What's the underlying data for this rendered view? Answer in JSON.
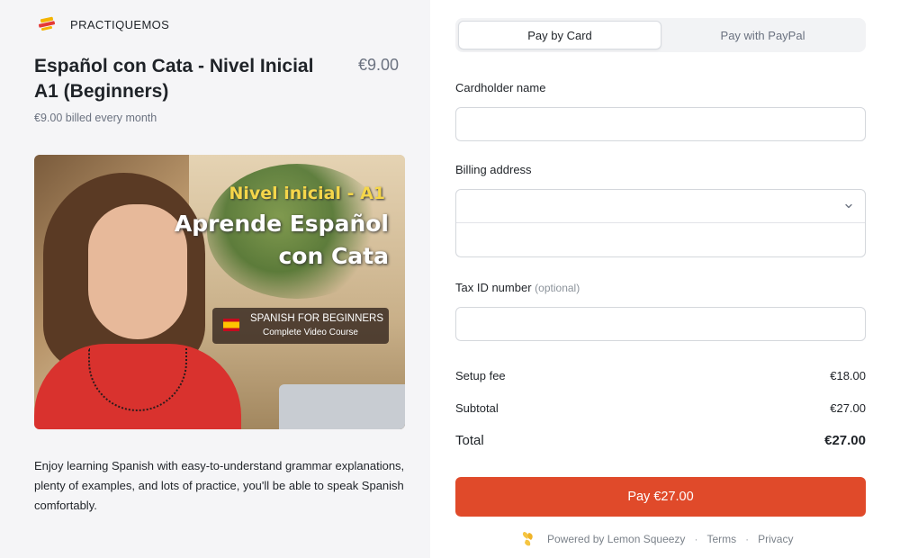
{
  "brand": {
    "name": "PRACTIQUEMOS",
    "logo_icon": "practiquemos-logo-icon"
  },
  "product": {
    "title": "Español con Cata - Nivel Inicial A1 (Beginners)",
    "price": "€9.00",
    "billing_note": "€9.00 billed every month",
    "media": {
      "line1": "Nivel inicial - A1",
      "line2": "Aprende Español",
      "line3": "con Cata",
      "badge_line1": "SPANISH FOR BEGINNERS",
      "badge_line2": "Complete Video Course"
    },
    "description": "Enjoy learning Spanish with easy-to-understand grammar explanations, plenty of examples, and lots of practice, you'll be able to speak Spanish comfortably."
  },
  "payment_tabs": [
    {
      "label": "Pay by Card",
      "active": true
    },
    {
      "label": "Pay with PayPal",
      "active": false
    }
  ],
  "form": {
    "cardholder_label": "Cardholder name",
    "cardholder_value": "",
    "billing_label": "Billing address",
    "billing_country": "",
    "billing_line": "",
    "tax_label": "Tax ID number",
    "tax_optional": "(optional)",
    "tax_value": ""
  },
  "summary": {
    "setup_fee_label": "Setup fee",
    "setup_fee_value": "€18.00",
    "subtotal_label": "Subtotal",
    "subtotal_value": "€27.00",
    "total_label": "Total",
    "total_value": "€27.00"
  },
  "pay_button_label": "Pay €27.00",
  "footer": {
    "powered_by": "Powered by Lemon Squeezy",
    "terms": "Terms",
    "privacy": "Privacy",
    "separator": "·"
  },
  "colors": {
    "accent": "#e04a2a",
    "left_panel_bg": "#f5f5f7",
    "muted_text": "#6b7280"
  }
}
